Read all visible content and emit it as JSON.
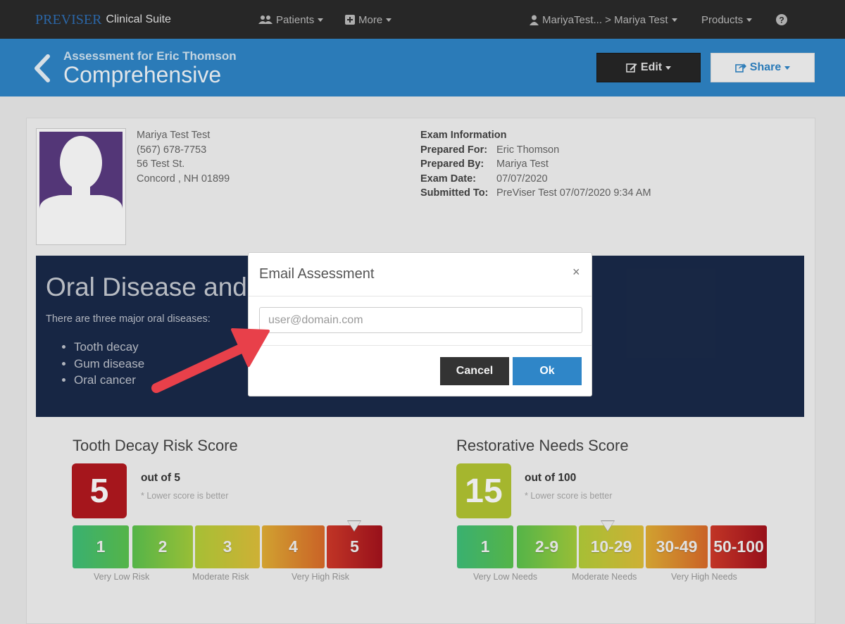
{
  "nav": {
    "brand_logo": "PREVISER",
    "brand_suite": "Clinical Suite",
    "patients": "Patients",
    "more": "More",
    "user": "MariyaTest... > Mariya Test",
    "products": "Products",
    "help_icon": "question-circle-icon"
  },
  "header": {
    "subtitle": "Assessment for Eric Thomson",
    "title": "Comprehensive",
    "edit_label": "Edit",
    "share_label": "Share",
    "background": "#2f86c8"
  },
  "contact": {
    "name": "Mariya Test Test",
    "phone": "(567) 678-7753",
    "street": "56 Test St.",
    "city": "Concord , NH 01899"
  },
  "exam": {
    "heading": "Exam Information",
    "rows": [
      {
        "label": "Prepared For:",
        "value": "Eric Thomson"
      },
      {
        "label": "Prepared By:",
        "value": "Mariya Test"
      },
      {
        "label": "Exam Date:",
        "value": "07/07/2020"
      },
      {
        "label": "Submitted To:",
        "value": "PreViser Test 07/07/2020 9:34 AM"
      }
    ]
  },
  "oral": {
    "title": "Oral Disease and",
    "intro": "There are three major oral diseases:",
    "items": [
      "Tooth decay",
      "Gum disease",
      "Oral cancer"
    ]
  },
  "decay": {
    "title": "Tooth Decay Risk Score",
    "score": "5",
    "out_of": "out of 5",
    "note": "* Lower score is better",
    "segments": [
      "1",
      "2",
      "3",
      "4",
      "5"
    ],
    "labels": [
      "Very Low Risk",
      "Moderate Risk",
      "Very High Risk"
    ]
  },
  "restorative": {
    "title": "Restorative Needs Score",
    "score": "15",
    "out_of": "out of 100",
    "note": "* Lower score is better",
    "segments": [
      "1",
      "2-9",
      "10-29",
      "30-49",
      "50-100"
    ],
    "labels": [
      "Very Low Needs",
      "Moderate Needs",
      "Very High Needs"
    ]
  },
  "modal": {
    "title": "Email Assessment",
    "close": "×",
    "placeholder": "user@domain.com",
    "value": "",
    "cancel": "Cancel",
    "ok": "Ok"
  },
  "colors": {
    "accent": "#2f86c8",
    "dark_panel": "#1a2a4a",
    "annotation_arrow": "#e8404a"
  }
}
